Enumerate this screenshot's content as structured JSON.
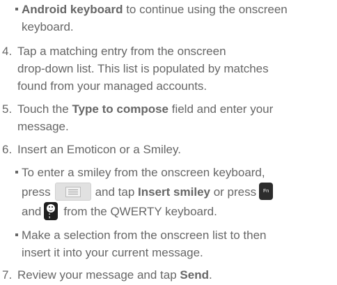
{
  "partial_item": {
    "bold": "Android keyboard",
    "text": " to continue using the onscreen",
    "cont": "keyboard."
  },
  "step4": {
    "num": "4.",
    "l1": "Tap a matching entry from the onscreen",
    "l2": "drop-down list. This list is populated by matches",
    "l3": "found from your managed accounts."
  },
  "step5": {
    "num": "5.",
    "pre": "Touch the ",
    "bold": "Type to compose",
    "post": " field and enter your",
    "l2": "message."
  },
  "step6": {
    "num": "6.",
    "text": "Insert an Emoticon or a Smiley.",
    "b1": {
      "l1": "To enter a smiley from the onscreen keyboard,",
      "press": "press",
      "and_tap": "and tap ",
      "bold": "Insert smiley",
      "or_press": " or press",
      "and": "and",
      "from": "from the QWERTY keyboard."
    },
    "b2": {
      "l1": "Make a selection from the onscreen list to then",
      "l2": "insert it into your current message."
    }
  },
  "step7": {
    "num": "7.",
    "pre": "Review your message and tap ",
    "bold": "Send",
    "post": "."
  },
  "icons": {
    "menu_key": "menu-key-icon",
    "fn_key": "fn-key-icon",
    "fn_label": "Fn",
    "smiley_key": "smiley-key-icon"
  }
}
